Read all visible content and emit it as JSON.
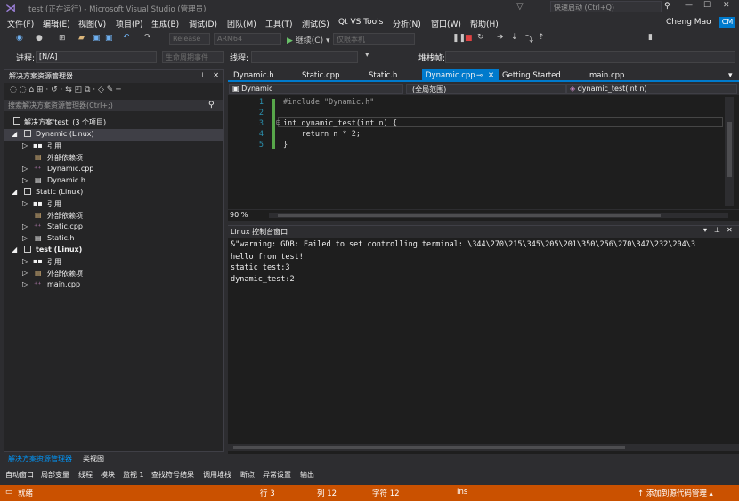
{
  "titlebar": {
    "title": "test (正在运行) - Microsoft Visual Studio (管理员)",
    "quick_launch": "快速启动 (Ctrl+Q)",
    "user": "Cheng Mao",
    "avatar": "CM"
  },
  "menu": [
    "文件(F)",
    "编辑(E)",
    "视图(V)",
    "项目(P)",
    "生成(B)",
    "调试(D)",
    "团队(M)",
    "工具(T)",
    "测试(S)",
    "Qt VS Tools",
    "分析(N)",
    "窗口(W)",
    "帮助(H)"
  ],
  "toolbar": {
    "config": "Release",
    "platform": "ARM64",
    "continue": "继续(C)",
    "target": "仅限本机",
    "process_label": "进程:",
    "process_value": "[N/A]",
    "lifecycle": "生命周期事件",
    "thread_label": "线程:",
    "stackframe_label": "堆栈帧:"
  },
  "solution": {
    "title": "解决方案资源管理器",
    "search_placeholder": "搜索解决方案资源管理器(Ctrl+;)",
    "root": "解决方案'test' (3 个项目)",
    "items": [
      {
        "label": "Dynamic (Linux)",
        "level": 1,
        "expanded": true,
        "selected": true
      },
      {
        "label": "引用",
        "level": 2
      },
      {
        "label": "外部依赖项",
        "level": 2
      },
      {
        "label": "Dynamic.cpp",
        "level": 2
      },
      {
        "label": "Dynamic.h",
        "level": 2
      },
      {
        "label": "Static (Linux)",
        "level": 1,
        "expanded": true
      },
      {
        "label": "引用",
        "level": 2
      },
      {
        "label": "外部依赖项",
        "level": 2
      },
      {
        "label": "Static.cpp",
        "level": 2
      },
      {
        "label": "Static.h",
        "level": 2
      },
      {
        "label": "test (Linux)",
        "level": 1,
        "expanded": true,
        "bold": true
      },
      {
        "label": "引用",
        "level": 2
      },
      {
        "label": "外部依赖项",
        "level": 2
      },
      {
        "label": "main.cpp",
        "level": 2
      }
    ],
    "bottom_tabs": [
      "解决方案资源管理器",
      "类视图"
    ]
  },
  "editor": {
    "tabs": [
      "Dynamic.h",
      "Static.cpp",
      "Static.h",
      "Dynamic.cpp",
      "Getting Started",
      "main.cpp"
    ],
    "active_tab": "Dynamic.cpp",
    "nav_project": "Dynamic",
    "nav_scope": "(全局范围)",
    "nav_function": "dynamic_test(int n)",
    "zoom": "90 %",
    "lines": [
      {
        "num": "1",
        "text": "#include \"Dynamic.h\""
      },
      {
        "num": "2",
        "text": ""
      },
      {
        "num": "3",
        "text": "int dynamic_test(int n) {"
      },
      {
        "num": "4",
        "text": "    return n * 2;"
      },
      {
        "num": "5",
        "text": "}"
      }
    ]
  },
  "console": {
    "title": "Linux 控制台窗口",
    "lines": [
      "&\"warning: GDB: Failed to set controlling terminal: \\344\\270\\215\\345\\205\\201\\350\\256\\270\\347\\232\\204\\3",
      "hello from test!",
      "static_test:3",
      "dynamic_test:2"
    ]
  },
  "bottom_tabs": [
    "自动窗口",
    "局部变量",
    "线程",
    "模块",
    "监视 1",
    "查找符号结果",
    "调用堆栈",
    "断点",
    "异常设置",
    "输出"
  ],
  "status": {
    "ready": "就绪",
    "row": "行 3",
    "col": "列 12",
    "char": "字符 12",
    "ins": "Ins",
    "source_control": "添加到源代码管理"
  },
  "colors": {
    "accent": "#007acc",
    "status": "#ca5100"
  }
}
